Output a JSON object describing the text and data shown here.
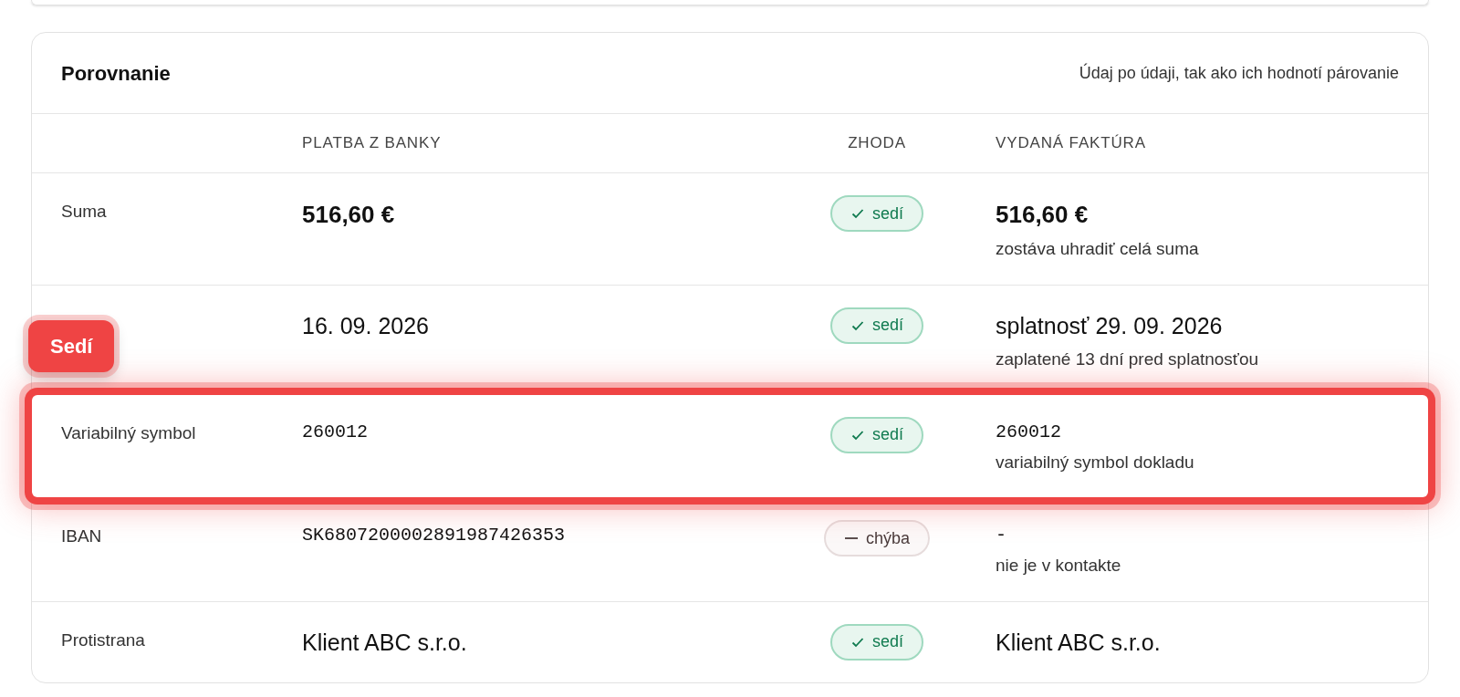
{
  "comparison": {
    "title": "Porovnanie",
    "subtitle": "Údaj po údaji, tak ako ich hodnotí párovanie",
    "columns": [
      "PLATBA Z BANKY",
      "ZHODA",
      "VYDANÁ FAKTÚRA"
    ],
    "rows": [
      {
        "kind": "amount",
        "label": "Suma",
        "bank": "516,60 €",
        "match": {
          "kind": "ok",
          "text": "sedí"
        },
        "invoice": "516,60 €",
        "note": "zostáva uhradiť celá suma",
        "highlighted": false
      },
      {
        "kind": "text",
        "bank": "16. 09. 2026",
        "match": {
          "kind": "ok",
          "text": "sedí"
        },
        "invoice": "splatnosť 29. 09. 2026",
        "note": "zaplatené 13 dní pred splatnosťou",
        "highlighted": false
      },
      {
        "kind": "code",
        "label": "Variabilný symbol",
        "bank": "260012",
        "match": {
          "kind": "ok",
          "text": "sedí"
        },
        "invoice": "260012",
        "note": "variabilný symbol dokladu",
        "highlighted": true,
        "tooltip": "Sedí"
      },
      {
        "kind": "code",
        "label": "IBAN",
        "bank": "SK6807200002891987426353",
        "match": {
          "kind": "missing",
          "text": "chýba"
        },
        "invoice": "-",
        "note": "nie je v kontakte",
        "highlighted": false
      },
      {
        "kind": "text",
        "label": "Protistrana",
        "bank": "Klient ABC s.r.o.",
        "match": {
          "kind": "ok",
          "text": "sedí"
        },
        "invoice": "Klient ABC s.r.o.",
        "highlighted": false
      }
    ]
  }
}
